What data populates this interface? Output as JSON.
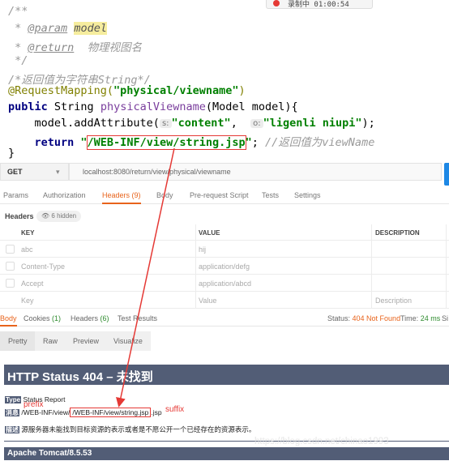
{
  "code": {
    "recording_label": "录制中 01:00:54",
    "lines": {
      "l1": "/**",
      "l2_star": " * ",
      "l2_tag": "@param",
      "l2_model": "model",
      "l3_star": " * ",
      "l3_tag": "@return",
      "l3_desc": "物理视图名",
      "l4": " */",
      "l5": "/*返回值为字符串String*/",
      "l6_ann": "@RequestMapping(",
      "l6_str": "\"physical/viewname\"",
      "l6_end": ")",
      "l7_kw": "public",
      "l7_type": " String ",
      "l7_fn": "physicalViewname",
      "l7_rest": "(Model model){",
      "l8_call": "    model.addAttribute(",
      "l8_hint1": "s:",
      "l8_str1": "\"content\"",
      "l8_mid": ",  ",
      "l8_hint2": "o:",
      "l8_str2": "\"ligenli niupi\"",
      "l8_end": ");",
      "l9_kw": "    return ",
      "l9_q1": "\"",
      "l9_path": "/WEB-INF/view/string.jsp",
      "l9_q2": "\"",
      "l9_semi": "; ",
      "l9_cmt_a": "//返回值为",
      "l9_cmt_b": "viewName",
      "l10": "}"
    }
  },
  "postman": {
    "method": "GET",
    "url": "localhost:8080/return/view/physical/viewname",
    "tabs": [
      "Params",
      "Authorization",
      "Headers (9)",
      "Body",
      "Pre-request Script",
      "Tests",
      "Settings"
    ],
    "headers_label": "Headers",
    "hidden_label": "6 hidden",
    "table": {
      "columns": [
        "KEY",
        "VALUE",
        "DESCRIPTION"
      ],
      "rows": [
        {
          "key": "abc",
          "value": "hij",
          "desc": ""
        },
        {
          "key": "Content-Type",
          "value": "application/defg",
          "desc": ""
        },
        {
          "key": "Accept",
          "value": "application/abcd",
          "desc": ""
        },
        {
          "key": "Key",
          "value": "Value",
          "desc": "Description"
        }
      ]
    },
    "response_tabs": {
      "body": "Body",
      "cookies": "Cookies",
      "cookies_n": "(1)",
      "headers": "Headers",
      "headers_n": "(6)",
      "results": "Test Results"
    },
    "status_label": "Status:",
    "status_value": "404 Not Found",
    "time_label": "Time:",
    "time_value": "24 ms",
    "size_label": "Si",
    "view_modes": [
      "Pretty",
      "Raw",
      "Preview",
      "Visualize"
    ]
  },
  "tomcat": {
    "title": "HTTP Status 404 – 未找到",
    "type_label": "Type",
    "type_value": "Status Report",
    "message_label": "消息",
    "msg_prefix": "/WEB-INF/view/",
    "msg_path": "/WEB-INF/view/string.jsp",
    "msg_suffix": ".jsp",
    "desc_label": "描述",
    "desc_value": "源服务器未能找到目标资源的表示或者是不愿公开一个已经存在的资源表示。",
    "footer": "Apache Tomcat/8.5.53"
  },
  "annotations": {
    "prefix": "prefix",
    "suffix": "suffix"
  },
  "watermark": "https://blog.csdn.net/chinao1993",
  "colors": {
    "accent": "#e8631b",
    "tomcat_bar": "#525d76",
    "annotation_red": "#e53935"
  }
}
